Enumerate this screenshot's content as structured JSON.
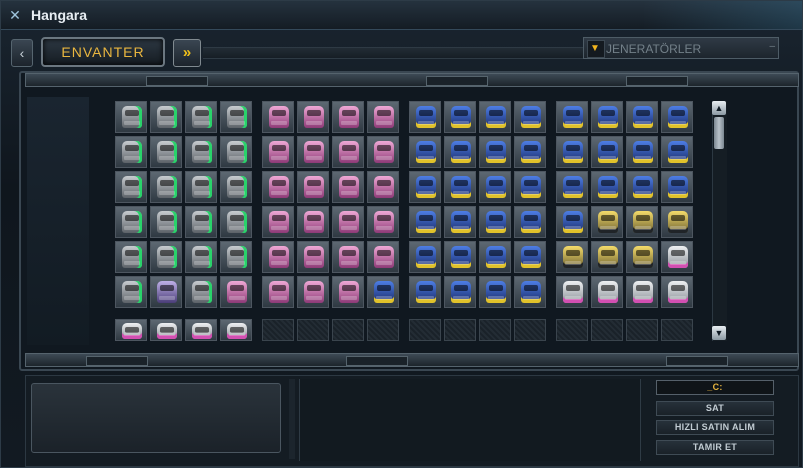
{
  "window": {
    "title": "Hangara"
  },
  "topbar": {
    "tab_label": "ENVANTER",
    "nav_left_glyph": "‹",
    "nav_right_glyph": "»",
    "dropdown": {
      "selected": "JENERATÖRLER",
      "arrow_glyph": "▼",
      "end_glyph": "–"
    }
  },
  "scrollbar": {
    "up_glyph": "▲",
    "down_glyph": "▼"
  },
  "actions": {
    "credit_label": "_C:",
    "sell_label": "SAT",
    "quick_buy_label": "HIZLI SATIN ALIM",
    "repair_label": "TAMIR ET"
  },
  "inventory": {
    "groups": [
      {
        "name": "gray-generators",
        "rows": [
          [
            "gray",
            "gray",
            "gray",
            "gray"
          ],
          [
            "gray",
            "gray",
            "gray",
            "gray"
          ],
          [
            "gray",
            "gray",
            "gray",
            "gray"
          ],
          [
            "gray",
            "gray",
            "gray",
            "gray"
          ],
          [
            "gray",
            "gray",
            "gray",
            "gray"
          ],
          [
            "gray",
            "purple",
            "gray",
            "pink"
          ],
          [
            "white",
            "white",
            "white",
            "white"
          ]
        ]
      },
      {
        "name": "pink-generators",
        "rows": [
          [
            "pink",
            "pink",
            "pink",
            "pink"
          ],
          [
            "pink",
            "pink",
            "pink",
            "pink"
          ],
          [
            "pink",
            "pink",
            "pink",
            "pink"
          ],
          [
            "pink",
            "pink",
            "pink",
            "pink"
          ],
          [
            "pink",
            "pink",
            "pink",
            "pink"
          ],
          [
            "pink",
            "pink",
            "pink",
            "blue"
          ],
          [
            "empty",
            "empty",
            "empty",
            "empty"
          ]
        ]
      },
      {
        "name": "blue-generators-a",
        "rows": [
          [
            "blue",
            "blue",
            "blue",
            "blue"
          ],
          [
            "blue",
            "blue",
            "blue",
            "blue"
          ],
          [
            "blue",
            "blue",
            "blue",
            "blue"
          ],
          [
            "blue",
            "blue",
            "blue",
            "blue"
          ],
          [
            "blue",
            "blue",
            "blue",
            "blue"
          ],
          [
            "blue",
            "blue",
            "blue",
            "blue"
          ],
          [
            "empty",
            "empty",
            "empty",
            "empty"
          ]
        ]
      },
      {
        "name": "blue-generators-b",
        "rows": [
          [
            "blue",
            "blue",
            "blue",
            "blue"
          ],
          [
            "blue",
            "blue",
            "blue",
            "blue"
          ],
          [
            "blue",
            "blue",
            "blue",
            "blue"
          ],
          [
            "blue",
            "gold",
            "gold",
            "gold"
          ],
          [
            "gold",
            "gold",
            "gold",
            "white"
          ],
          [
            "white",
            "white",
            "white",
            "white"
          ],
          [
            "empty",
            "empty",
            "empty",
            "empty"
          ]
        ]
      }
    ]
  },
  "colors": {
    "accent": "#e9b63f",
    "frame": "#3a4752",
    "background": "#0c1218"
  }
}
